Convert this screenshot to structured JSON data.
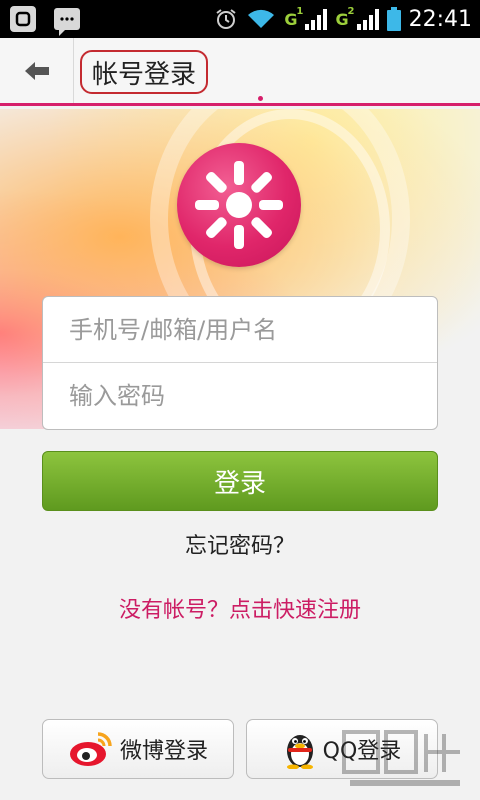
{
  "status_bar": {
    "time": "22:41",
    "network_1": "G",
    "network_1_sub": "1",
    "network_2": "G",
    "network_2_sub": "2",
    "icons": [
      "app-notification-icon",
      "message-icon",
      "alarm-icon",
      "wifi-icon",
      "signal-icon",
      "battery-icon"
    ]
  },
  "header": {
    "back_icon": "back-arrow-icon",
    "title": "帐号登录"
  },
  "form": {
    "username_placeholder": "手机号/邮箱/用户名",
    "password_placeholder": "输入密码"
  },
  "actions": {
    "login_label": "登录",
    "forgot_label": "忘记密码？",
    "register_label": "没有帐号？点击快速注册"
  },
  "social": {
    "weibo_label": "微博登录",
    "qq_label": "QQ登录"
  },
  "colors": {
    "accent": "#d61f6b",
    "login_button": "#74ad2c",
    "register_link": "#cc1d64"
  }
}
